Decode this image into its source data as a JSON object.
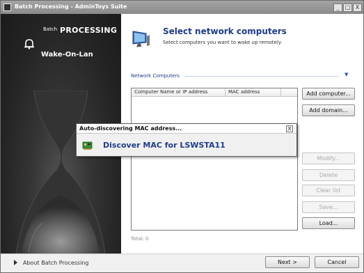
{
  "window": {
    "title": "Batch Processing - AdminToys Suite",
    "minimize": "_",
    "maximize": "□",
    "close": "X"
  },
  "sidebar": {
    "brand_small": "Batch",
    "brand_big": "PROCESSING",
    "product": "Wake-On-Lan",
    "about_link": "About Batch Processing"
  },
  "header": {
    "title": "Select network computers",
    "subtitle": "Select computers you want to wake up remotely."
  },
  "section": {
    "label": "Network Computers"
  },
  "listview": {
    "columns": [
      "Computer Name or IP address",
      "MAC address"
    ],
    "rows": []
  },
  "total_label": "Total: 0",
  "buttons": {
    "add_computer": "Add computer...",
    "add_domain": "Add domain...",
    "modify": "Modify...",
    "delete": "Delete",
    "clear_list": "Clear list",
    "save": "Save...",
    "load": "Load...",
    "next": "Next >",
    "cancel": "Cancel"
  },
  "popup": {
    "title": "Auto-discovering MAC address...",
    "message": "Discover MAC for LSWSTA11",
    "close": "X"
  },
  "colors": {
    "accent": "#1e3c8e",
    "titlebar": "#8f8f8f",
    "sidebar": "#262626"
  },
  "icons": {
    "app": "app-icon",
    "logo": "bell-logo-icon",
    "header": "computer-monitor-icon",
    "popup": "network-card-icon",
    "about": "triangle-arrow-icon"
  }
}
